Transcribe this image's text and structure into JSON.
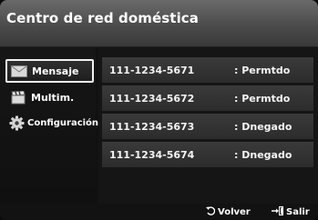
{
  "header": {
    "title": "Centro de red doméstica"
  },
  "sidebar": {
    "items": [
      {
        "label": "Mensaje",
        "icon": "envelope-icon",
        "selected": true
      },
      {
        "label": "Multim.",
        "icon": "clapperboard-icon",
        "selected": false
      },
      {
        "label": "Configuración",
        "icon": "gear-icon",
        "selected": false
      }
    ]
  },
  "messages": [
    {
      "number": "111-1234-5671",
      "status": ": Permtdo"
    },
    {
      "number": "111-1234-5672",
      "status": ": Permtdo"
    },
    {
      "number": "111-1234-5673",
      "status": ": Dnegado"
    },
    {
      "number": "111-1234-5674",
      "status": ": Dnegado"
    }
  ],
  "footer": {
    "back_label": "Volver",
    "back_icon": "return-icon",
    "exit_label": "Salir",
    "exit_icon": "exit-icon"
  }
}
